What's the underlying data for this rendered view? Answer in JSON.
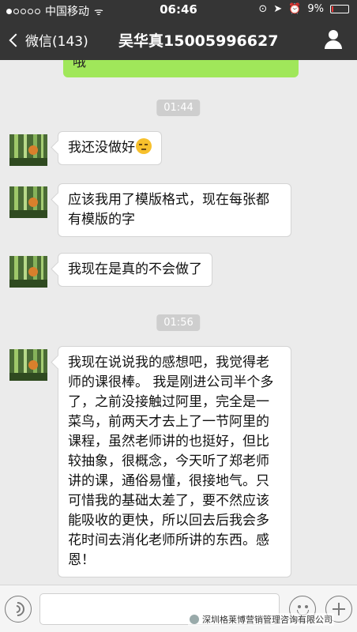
{
  "status_bar": {
    "carrier": "中国移动",
    "time": "06:46",
    "battery": "9%",
    "battery_level": 0.09
  },
  "nav": {
    "back_label": "微信(143)",
    "title": "吴华真15005996627"
  },
  "messages": {
    "partial_outgoing": "哦",
    "time1": "01:44",
    "msg1": "我还没做好",
    "msg2": "应该我用了模版格式，现在每张都有模版的字",
    "msg3": "我现在是真的不会做了",
    "time2": "01:56",
    "msg4": "我现在说说我的感想吧，我觉得老师的课很棒。 我是刚进公司半个多了，之前没接触过阿里，完全是一菜鸟，前两天才去上了一节阿里的课程，虽然老师讲的也挺好，但比较抽象，很概念，今天听了郑老师讲的课，通俗易懂，很接地气。只可惜我的基础太差了，要不然应该能吸收的更快，所以回去后我会多花时间去消化老师所讲的东西。感恩！"
  },
  "icons": [
    "back-chevron-icon",
    "contact-info-icon",
    "voice-icon",
    "emoji-face-icon",
    "plus-icon",
    "wifi-icon",
    "location-icon",
    "alarm-icon"
  ],
  "watermark": "深圳格莱博营销管理咨询有限公司",
  "colors": {
    "navbar": "#353535",
    "chat_bg": "#ebebeb",
    "outgoing_bubble": "#a0e75a",
    "incoming_bubble": "#ffffff",
    "timestamp_bg": "#cecece"
  }
}
